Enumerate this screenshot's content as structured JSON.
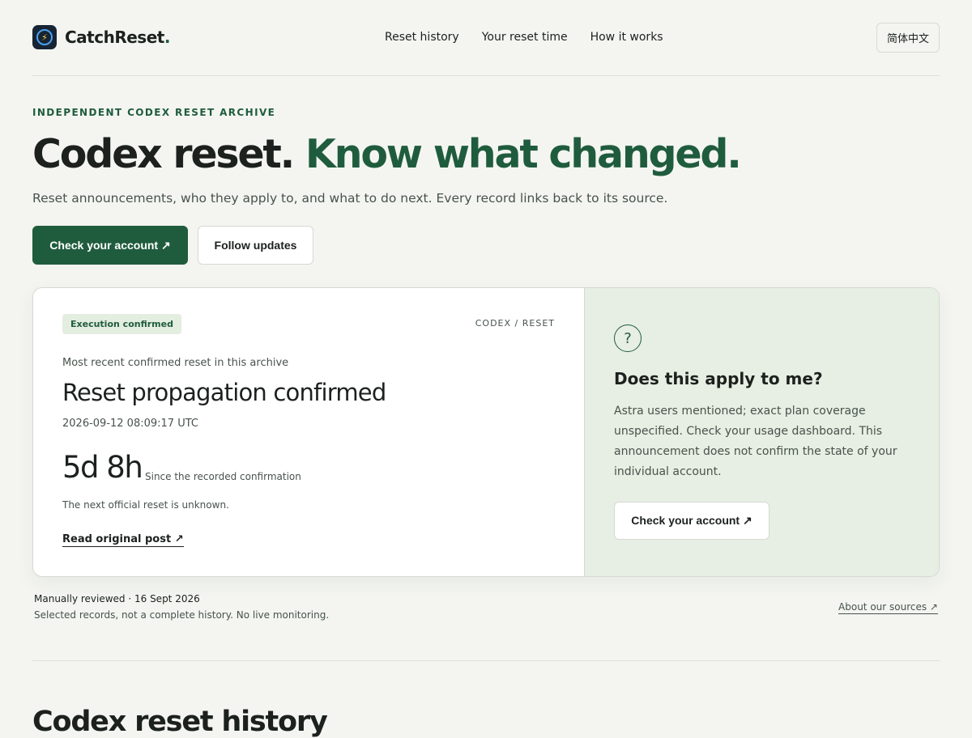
{
  "brand": {
    "name": "CatchReset",
    "dot": "."
  },
  "nav": {
    "items": [
      "Reset history",
      "Your reset time",
      "How it works"
    ]
  },
  "lang_button": "简体中文",
  "hero": {
    "eyebrow": "INDEPENDENT CODEX RESET ARCHIVE",
    "title_main": "Codex reset.",
    "title_accent": "Know what changed.",
    "lede": "Reset announcements, who they apply to, and what to do next. Every record links back to its source."
  },
  "actions": {
    "primary": "Check your account ↗",
    "secondary": "Follow updates"
  },
  "record": {
    "badge": "Execution confirmed",
    "crumb": "CODEX / RESET",
    "subtitle": "Most recent confirmed reset in this archive",
    "title": "Reset propagation confirmed",
    "timestamp": "2026-09-12 08:09:17 UTC",
    "elapsed": "5d 8h",
    "elapsed_caption": "Since the recorded confirmation",
    "next_reset": "The next official reset is unknown.",
    "link": "Read original post ↗"
  },
  "applies": {
    "icon": "question-icon",
    "glyph": "?",
    "title": "Does this apply to me?",
    "body": "Astra users mentioned; exact plan coverage unspecified. Check your usage dashboard. This announcement does not confirm the state of your individual account.",
    "button": "Check your account ↗"
  },
  "meta": {
    "reviewed": "Manually reviewed · 16 Sept 2026",
    "records_note": "Selected records, not a complete history. No live monitoring.",
    "about": "About our sources ↗"
  },
  "history": {
    "title": "Codex reset history"
  },
  "colors": {
    "accent": "#1f5c3d",
    "background": "#f4f5f1",
    "panel": "#e7eee3"
  }
}
